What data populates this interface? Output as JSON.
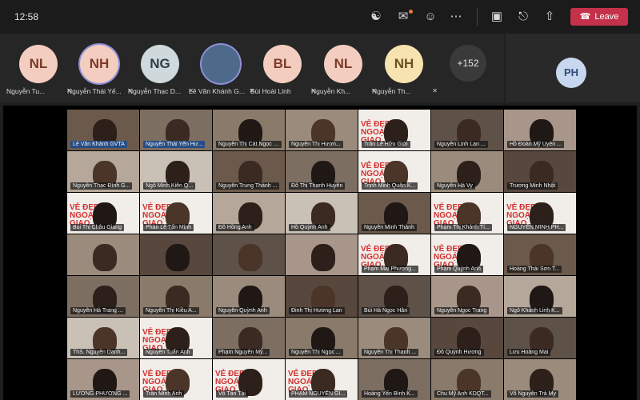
{
  "topbar": {
    "clock": "12:58",
    "leave_label": "Leave",
    "icons": [
      "people-icon",
      "chat-icon",
      "reactions-icon",
      "more-icon",
      "camera-off-icon",
      "mic-off-icon",
      "share-icon"
    ]
  },
  "strip": {
    "attendees": [
      {
        "initials": "NL",
        "name": "Nguyễn Tu...",
        "bg": "#f3cdbf",
        "fg": "#7a3b2b"
      },
      {
        "initials": "NH",
        "name": "Nguyễn Thái Yế...",
        "bg": "#f3cdbf",
        "fg": "#7a3b2b"
      },
      {
        "initials": "NG",
        "name": "Nguyễn Thạc D...",
        "bg": "#cfd8dc",
        "fg": "#2f3e45"
      },
      {
        "initials": "",
        "name": "Lê Văn Khánh G...",
        "bg": "#4d6a8a",
        "fg": "#ffffff"
      },
      {
        "initials": "BL",
        "name": "Bùi Hoài Linh",
        "bg": "#f3cdbf",
        "fg": "#7a3b2b"
      },
      {
        "initials": "NL",
        "name": "Nguyễn Kh...",
        "bg": "#f3cdbf",
        "fg": "#7a3b2b"
      },
      {
        "initials": "NH",
        "name": "Nguyễn Th...",
        "bg": "#f6e3b0",
        "fg": "#6a5222"
      }
    ],
    "more_count": "+152",
    "panel_initials": "PH"
  },
  "poster_text": "VẺ ĐẸP NGOẠI GIAO",
  "tiles": [
    "Lê Văn Khánh GVTA",
    "Nguyễn Thái Yến Hư...",
    "Nguyễn Thị Cát Ngọc GV...",
    "Nguyễn Thị Hươn...",
    "Trần Lê Hữu Giới",
    "Nguyễn Linh Lan ...",
    "Hồ Đoàn Mỹ Uyên ...",
    "Nguyễn Thạc Đình G...",
    "Ngô Minh Kiên Q...",
    "Nguyễn Trung Thành ...",
    "Đỗ Thị Thanh Huyền",
    "Trịnh Minh Quân K...",
    "Nguyễn Hà Vy",
    "Trương Minh Nhật",
    "Bùi Thị Châu Giang",
    "Phan Lê Tấn Minh",
    "Đỗ Hồng Anh",
    "Hồ Quỳnh Anh",
    "Nguyễn Minh Thành",
    "Phạm Thị Khánh Tí...",
    "NGUYỄN MINH PH...",
    "",
    "",
    "",
    "",
    "Phạm Mai Phương...",
    "Phạm Quỳnh Anh",
    "Hoàng Thái Sơn T...",
    "Nguyễn Hà Trang ...",
    "Nguyễn Thị Kiều A...",
    "Nguyễn Quỳnh Anh",
    "Đinh Thị Hương Lan",
    "Bùi Hà Ngọc Hân",
    "Nguyễn Ngọc Trang",
    "Ngô Khánh Linh K...",
    "ThS. Nguyễn Danh...",
    "Nguyễn Tuấn Anh",
    "Phạm Nguyễn Mỹ...",
    "Nguyễn Thị Ngọc ...",
    "Nguyễn Thị Thanh ...",
    "Đỗ Quỳnh Hương",
    "Lưu Hoàng Mai",
    "LƯƠNG PHƯƠNG ...",
    "Trần Minh Anh",
    "Võ Tấn Tài",
    "PHẠM NGUYỄN GI...",
    "Hoàng Yến Bình K...",
    "Chu Mỹ Anh KDQT...",
    "Võ Nguyễn Trà My"
  ],
  "colors": {
    "leave": "#c4314b",
    "highlight_label": "#274d86",
    "poster_red": "#d23131"
  }
}
